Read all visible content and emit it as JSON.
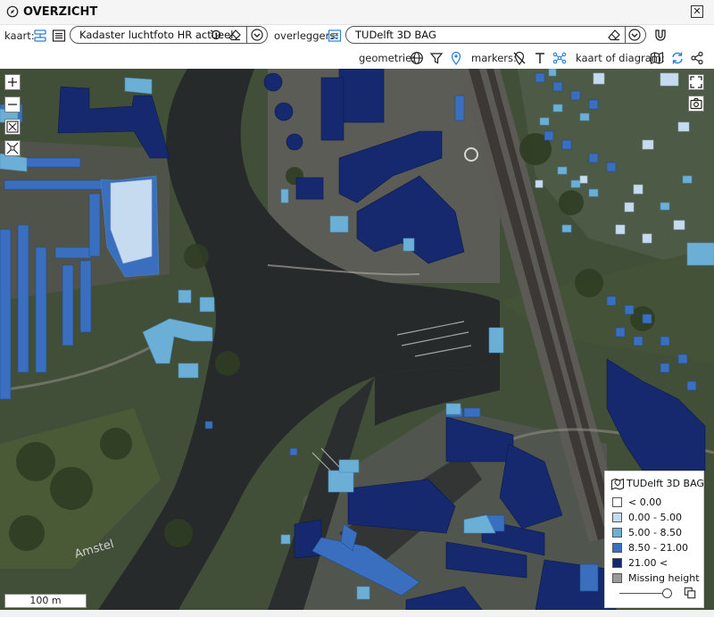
{
  "panel": {
    "title": "OVERZICHT"
  },
  "toolbar": {
    "kaart_label": "kaart:",
    "base_layer": "Kadaster luchtfoto HR actueel",
    "overlays_label": "overleggers:",
    "overlay_layer": "TUDelft 3D BAG",
    "geometry_label": "geometrie:",
    "markers_label": "markers:",
    "map_or_chart_label": "kaart of diagram:"
  },
  "map": {
    "scale_label": "100 m",
    "place_labels": [
      "Amstel"
    ]
  },
  "legend": {
    "title": "TUDelft 3D BAG",
    "classes": [
      {
        "label": "< 0.00",
        "color": "#ffffff"
      },
      {
        "label": "0.00 - 5.00",
        "color": "#c6dbef"
      },
      {
        "label": "5.00 - 8.50",
        "color": "#6baed6"
      },
      {
        "label": "8.50 - 21.00",
        "color": "#3a6fbf"
      },
      {
        "label": "21.00 <",
        "color": "#16286e"
      },
      {
        "label": "Missing height",
        "color": "#9a9a9a"
      }
    ]
  },
  "colors": {
    "water": "#272a2a",
    "vegetation": "#3b4a2e",
    "building_tall": "#16286e",
    "building_mid": "#3a6fbf",
    "building_low": "#6baed6",
    "building_vlow": "#c6dbef",
    "accent_icon": "#2f7fd6"
  }
}
